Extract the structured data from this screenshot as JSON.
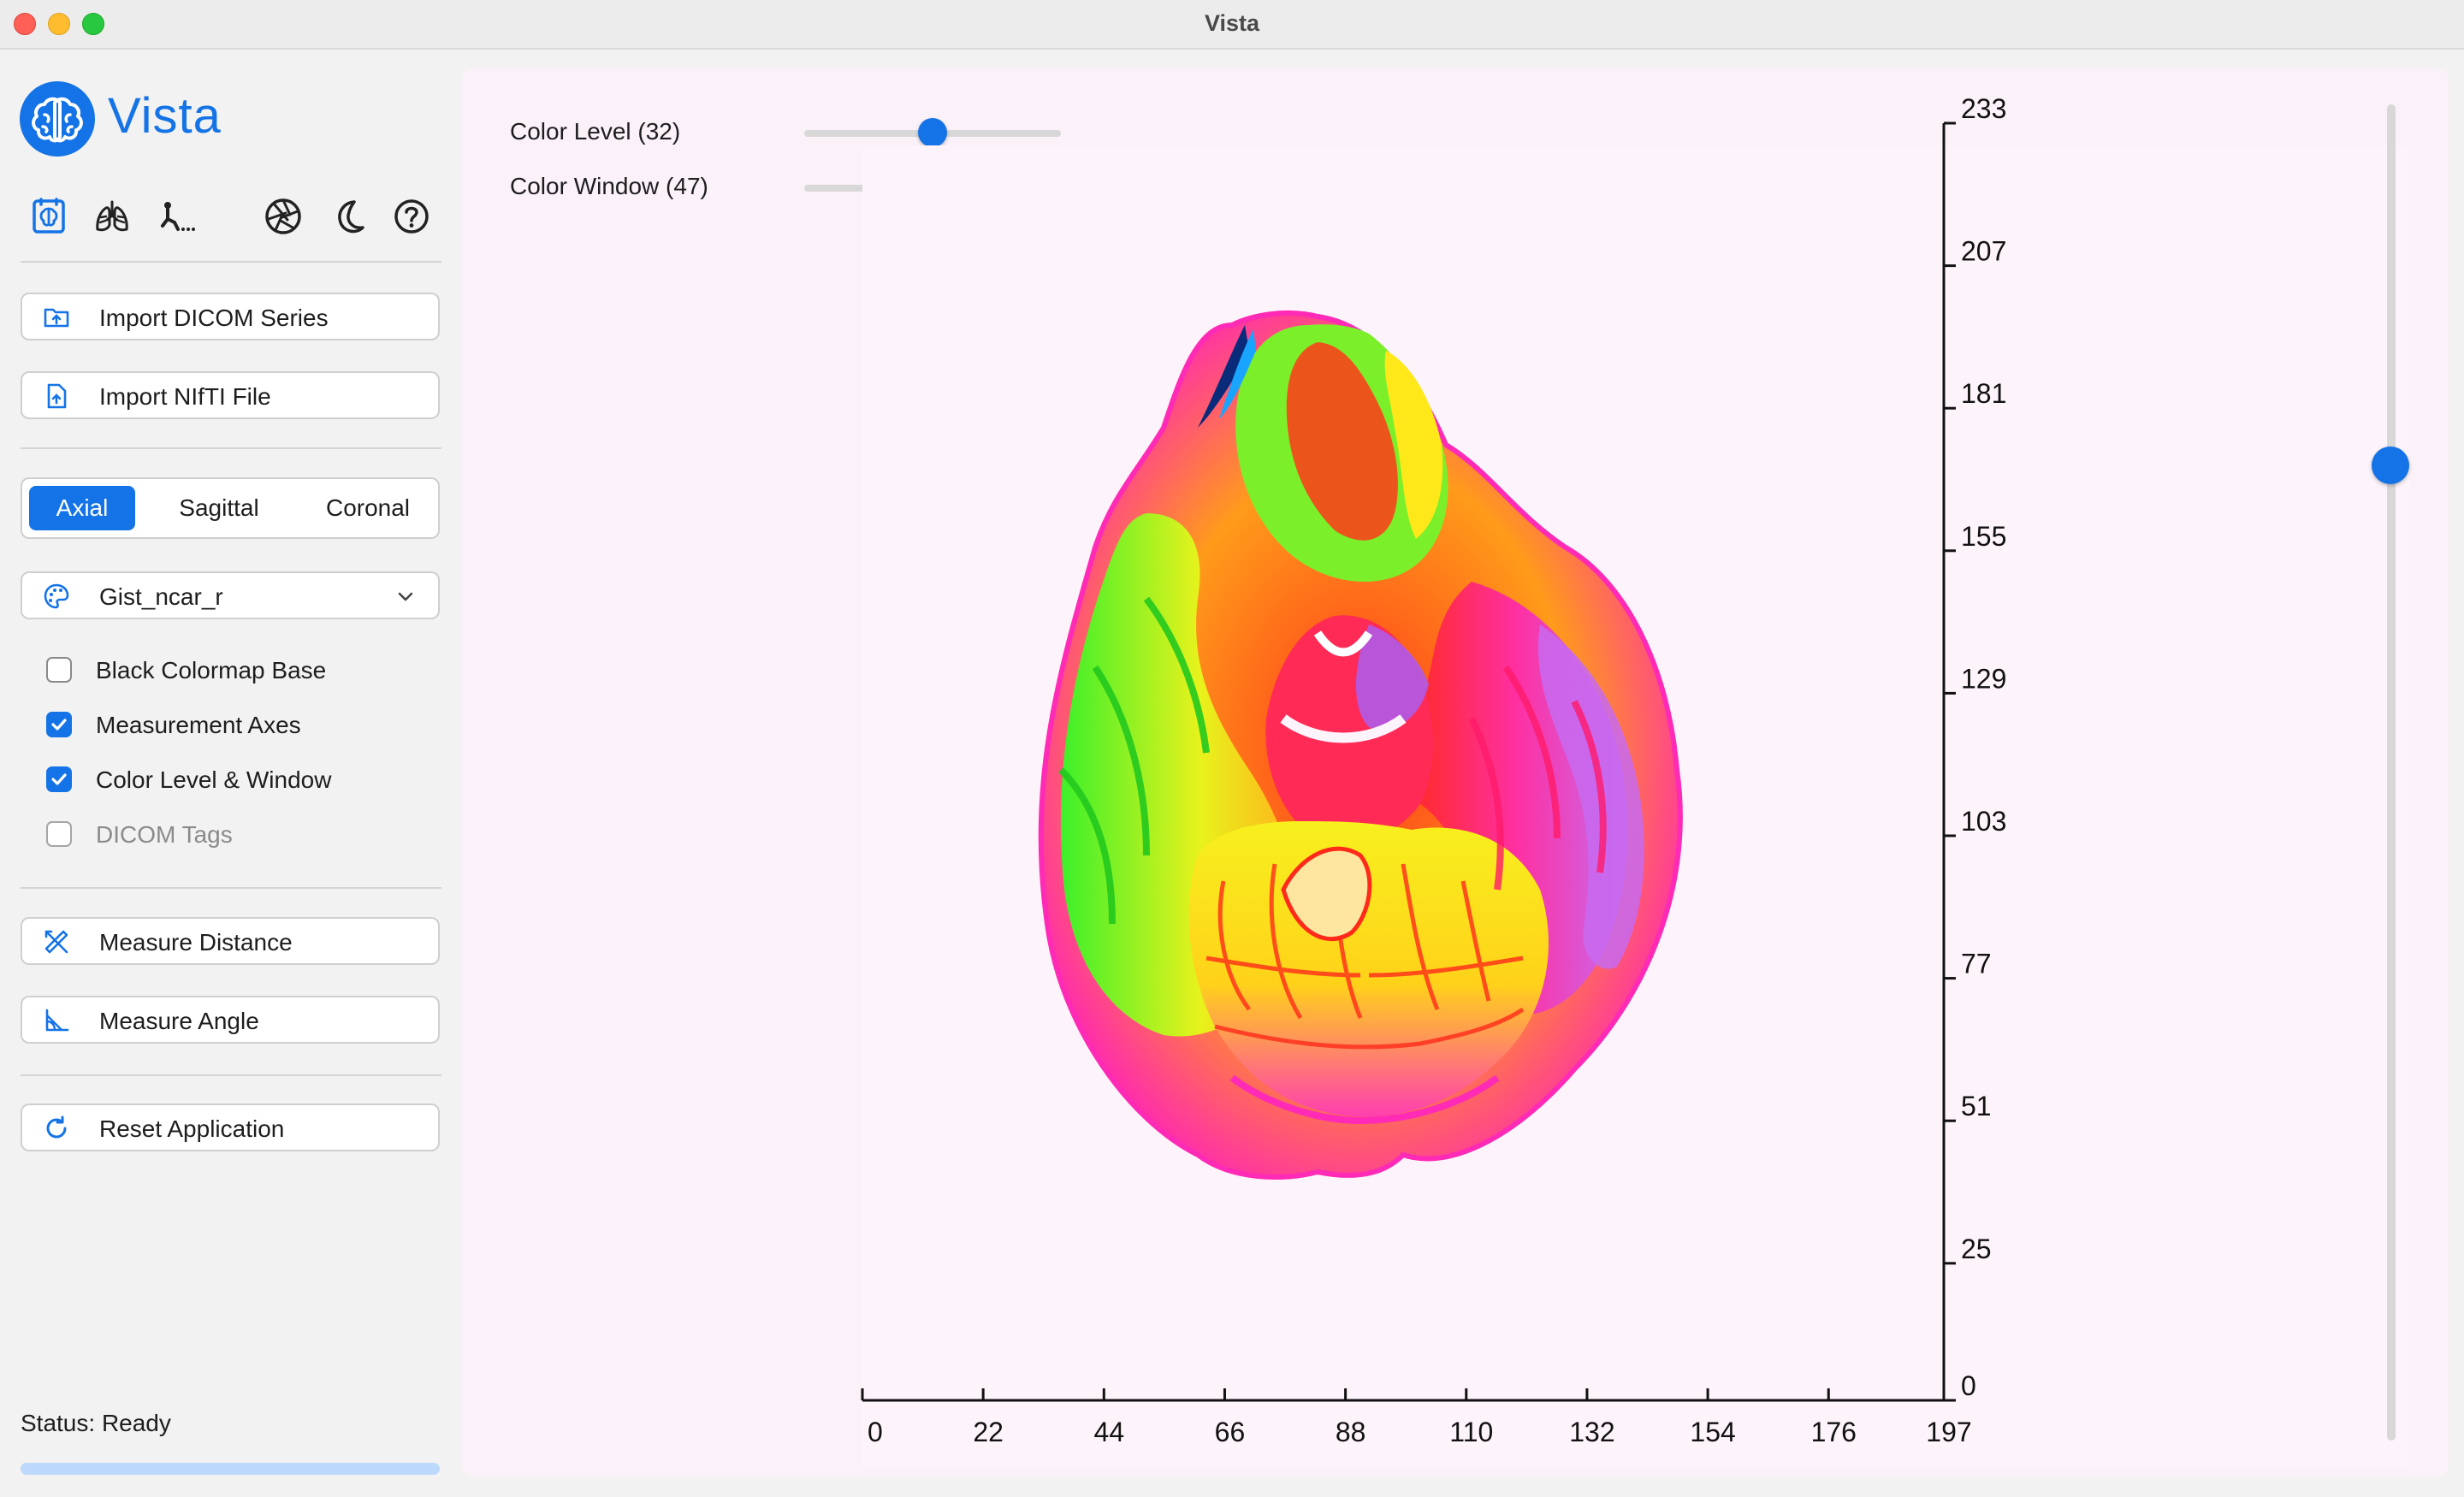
{
  "window": {
    "title": "Vista"
  },
  "app": {
    "name": "Vista"
  },
  "toolbar": {
    "icons": [
      "brain-scan-icon",
      "lungs-icon",
      "bone-icon",
      "aperture-icon",
      "moon-icon",
      "help-icon"
    ]
  },
  "actions": {
    "import_dicom": "Import DICOM Series",
    "import_nifti": "Import NIfTI File",
    "measure_distance": "Measure Distance",
    "measure_angle": "Measure Angle",
    "reset": "Reset Application"
  },
  "view_modes": {
    "axial": "Axial",
    "sagittal": "Sagittal",
    "coronal": "Coronal",
    "selected": "Axial"
  },
  "colormap": {
    "selected": "Gist_ncar_r"
  },
  "options": {
    "black_base": {
      "label": "Black Colormap Base",
      "checked": false
    },
    "measurement_axes": {
      "label": "Measurement Axes",
      "checked": true
    },
    "color_level_window": {
      "label": "Color Level & Window",
      "checked": true
    },
    "dicom_tags": {
      "label": "DICOM Tags",
      "checked": false,
      "disabled": true
    }
  },
  "status": {
    "text": "Status: Ready"
  },
  "viewer": {
    "color_level_label": "Color Level (32)",
    "color_window_label": "Color Window (47)",
    "color_level_fraction": 0.5,
    "color_window_fraction": 0.73,
    "slice_fraction": 0.27,
    "x_ticks": [
      "0",
      "22",
      "44",
      "66",
      "88",
      "110",
      "132",
      "154",
      "176",
      "197"
    ],
    "y_ticks": [
      "0",
      "25",
      "51",
      "77",
      "103",
      "129",
      "155",
      "181",
      "207",
      "233"
    ]
  },
  "colors": {
    "accent": "#1473e6",
    "panel_background": "#fbf1f9"
  }
}
